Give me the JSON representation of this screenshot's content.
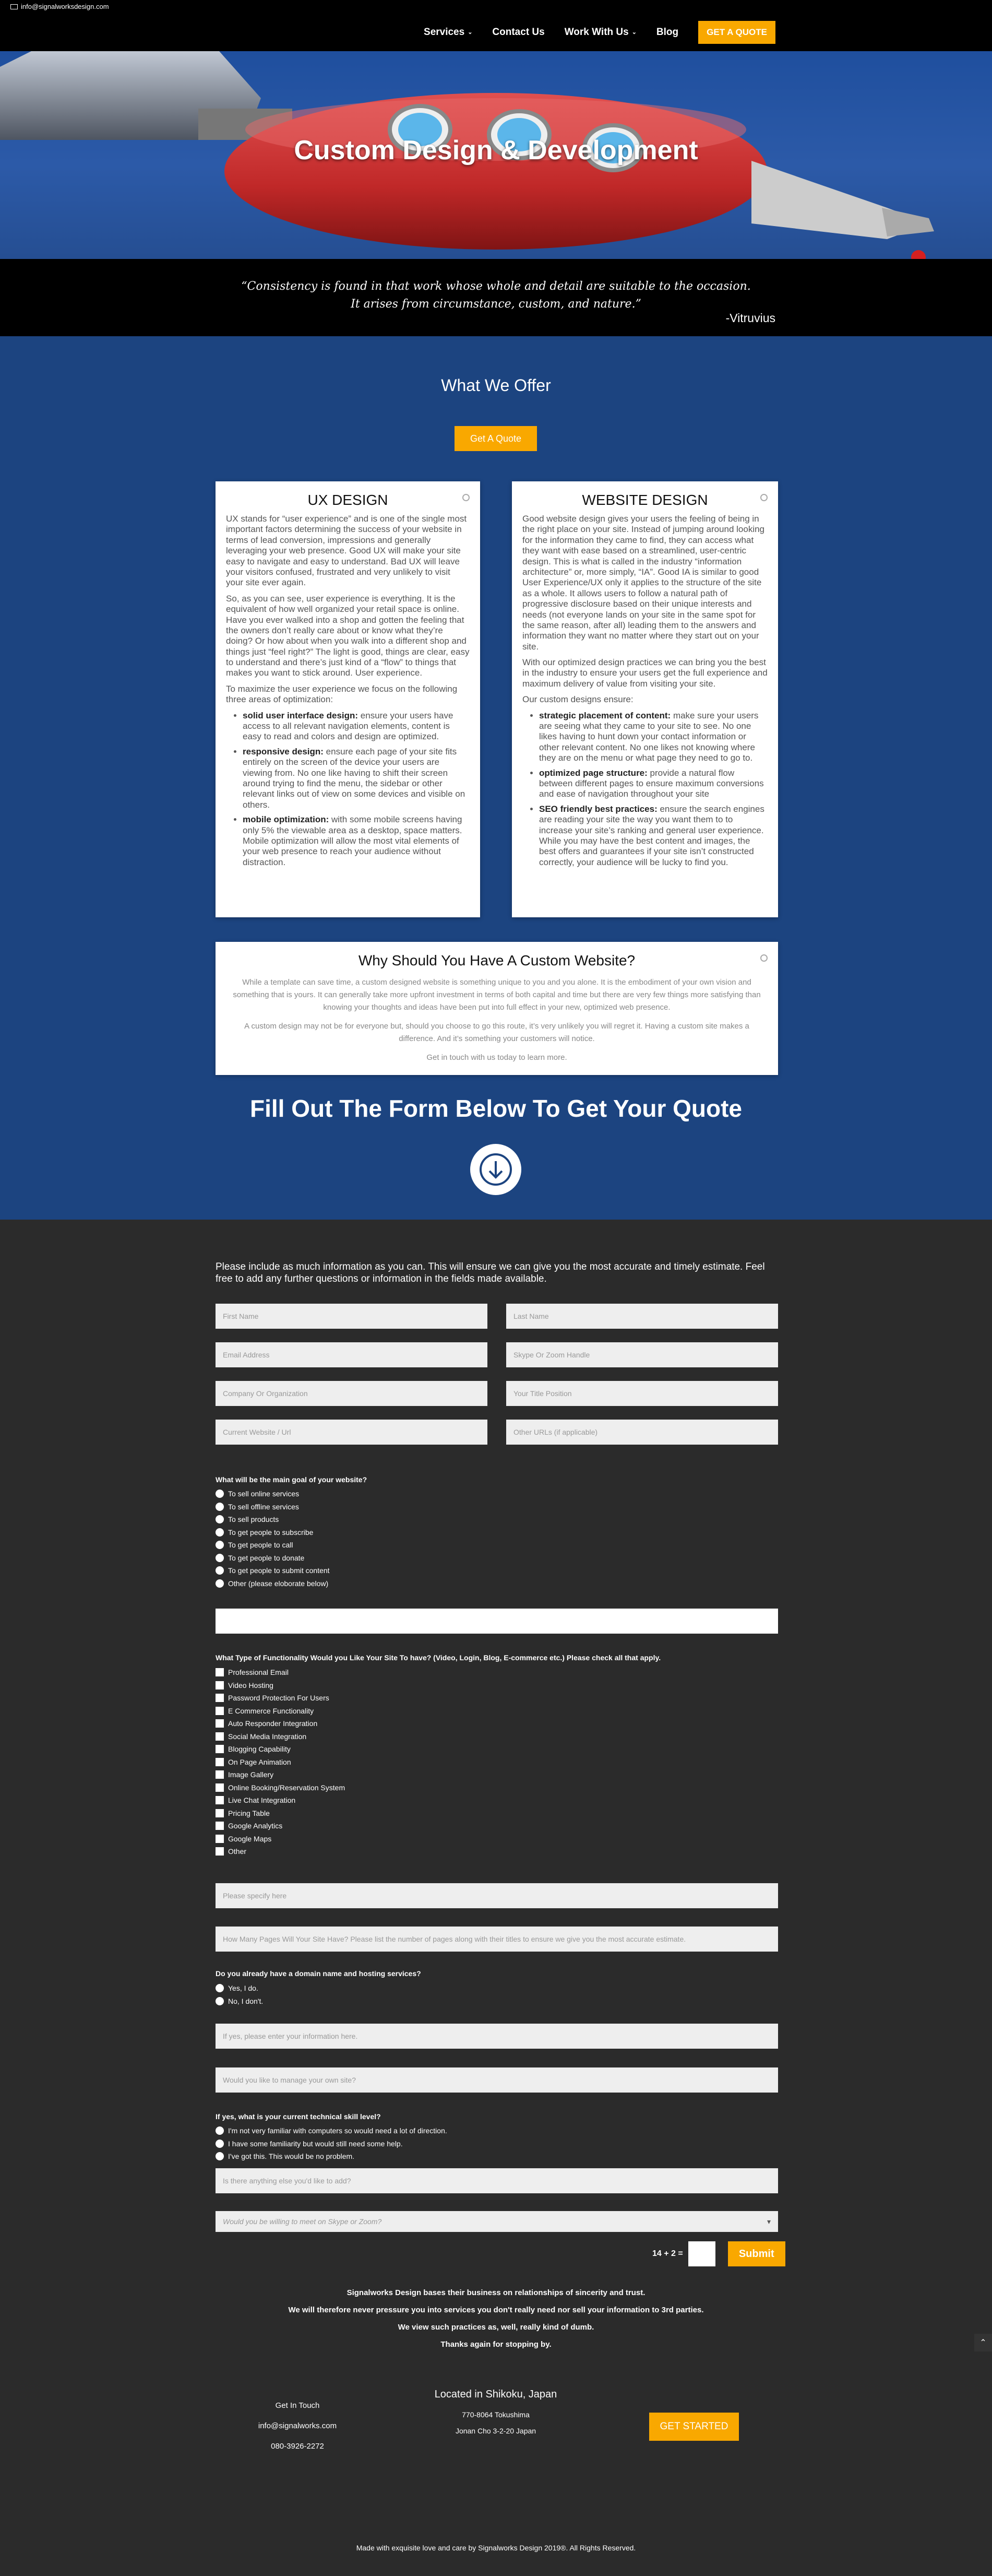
{
  "topbar": {
    "email": "info@signalworksdesign.com"
  },
  "nav": {
    "items": [
      "Services",
      "Contact Us",
      "Work With Us",
      "Blog"
    ],
    "quote_button": "GET A QUOTE"
  },
  "hero": {
    "title": "Custom Design & Development"
  },
  "quote": {
    "line1": "“Consistency is found in that work whose whole and detail are suitable to the occasion.",
    "line2": "It arises from circumstance, custom, and nature.”",
    "author": "-Vitruvius"
  },
  "offer": {
    "title": "What We Offer",
    "button": "Get A Quote",
    "ux": {
      "title": "UX DESIGN",
      "p1": "UX stands for “user experience” and is one of the single most important factors determining the success of your website in terms of lead conversion, impressions and generally leveraging your web presence. Good UX will make your site easy to navigate and easy to understand.  Bad UX will leave your visitors confused, frustrated and very unlikely to visit your site ever again.",
      "p2": "So, as you can see, user experience is everything. It is the equivalent of how well organized your retail space is online. Have you ever walked into a shop and gotten the feeling that the owners don’t really care about or know what they’re doing? Or how about when you walk into a different shop and things just “feel right?” The light is good, things are clear, easy to understand and there’s just kind of a “flow” to things that makes you want to stick around. User experience.",
      "p3": "To maximize the user experience we focus on the following three areas of optimization:",
      "bullets": [
        {
          "b": "solid user interface design:",
          "t": " ensure your users have access to all relevant navigation elements, content is easy to read and colors and design are optimized."
        },
        {
          "b": "responsive design:",
          "t": " ensure each page of your site fits entirely on the screen of the device your users are viewing from. No one like having to shift their screen around trying to find the menu, the sidebar or other relevant links out of view on some devices and visible on others."
        },
        {
          "b": "mobile optimization:",
          "t": " with some mobile screens having only 5% the viewable area as a desktop, space matters. Mobile optimization will allow the most vital elements of your web presence to reach your audience without distraction."
        }
      ]
    },
    "web": {
      "title": "WEBSITE DESIGN",
      "p1": "Good website design gives your users the feeling of being in the right place on your site. Instead of jumping around looking for the information they came to find, they can access what they want with ease based on a streamlined, user-centric design. This is what is called in the industry “information architecture” or, more simply, “IA”.  Good IA is similar to good User Experience/UX only it applies to the structure of the site as a whole. It allows users to follow a natural path of progressive disclosure based on their unique interests and needs (not everyone lands on your site in the same spot for the same reason, after all) leading them to the answers and information they want no matter where they start out on your site.",
      "p2": "With our optimized design practices we can bring you the best in the industry to ensure your users get the full experience and maximum delivery of value from visiting your site.",
      "p3": "Our custom designs ensure:",
      "bullets": [
        {
          "b": "strategic placement of content:",
          "t": " make sure your users are seeing what they came to your site to see. No one likes having to hunt down your contact information or other relevant content. No one likes not knowing where they are on the menu or what page they need to go to."
        },
        {
          "b": "optimized page structure:",
          "t": " provide a natural flow between different pages to ensure maximum conversions and ease of navigation throughout your site"
        },
        {
          "b": "SEO friendly best practices:",
          "t": " ensure the search engines are reading your site the way you want them to to increase your site’s ranking and general user experience. While you may have the best content and images, the best offers and guarantees if your site isn’t constructed correctly, your audience will be lucky to find you."
        }
      ]
    },
    "why": {
      "title": "Why Should You Have A Custom Website?",
      "p1": "While a template can save time, a custom designed website is something unique to you and you alone. It is the embodiment of your own vision and something that is yours. It can generally take more upfront investment in terms of both capital and time but there are very few things more satisfying than knowing your thoughts and ideas have been put into full effect in your new, optimized web presence.",
      "p2": "A custom design may not be for everyone but, should you choose to go this route, it’s very unlikely you will regret it. Having a custom site makes a difference. And it’s something your customers will notice.",
      "p3": "Get in touch with us today to learn more."
    },
    "fill_title": "Fill Out The Form Below To Get Your Quote"
  },
  "form": {
    "intro": "Please include as much information as you can. This will ensure we can give you the most accurate and timely estimate. Feel free to add any further questions or information in the fields made available.",
    "first_name": "First Name",
    "last_name": "Last Name",
    "email": "Email Address",
    "skype": "Skype Or Zoom Handle",
    "company": "Company Or Organization",
    "title_position": "Your Title Position",
    "current_website": "Current Website / Url",
    "other_urls": "Other URLs (if applicable)",
    "goal_label": "What will be the main goal of your website?",
    "goals": [
      "To sell online services",
      "To sell offline services",
      "To sell products",
      "To get people to subscribe",
      "To get people to call",
      "To get people to donate",
      "To get people to submit content",
      "Other (please eloborate below)"
    ],
    "func_label": "What Type of Functionality Would you Like Your Site To have? (Video, Login, Blog, E-commerce etc.) Please check all that apply.",
    "functions": [
      "Professional Email",
      "Video Hosting",
      "Password Protection For Users",
      "E Commerce Functionality",
      "Auto Responder Integration",
      "Social Media Integration",
      "Blogging Capability",
      "On Page Animation",
      "Image Gallery",
      "Online Booking/Reservation System",
      "Live Chat Integration",
      "Pricing Table",
      "Google Analytics",
      "Google Maps",
      "Other"
    ],
    "specify": "Please specify here",
    "pages": "How Many Pages Will Your Site Have? Please list the number of pages along with their titles to ensure we give you the most accurate estimate.",
    "domain_label": "Do you already have a domain name and hosting services?",
    "domain_opts": [
      "Yes, I do.",
      "No, I don't."
    ],
    "domain_info": "If yes, please enter your information here.",
    "manage": "Would you like to manage your own site?",
    "skill_label": "If yes, what is your current technical skill level?",
    "skills": [
      "I'm not very familiar with computers so would need a lot of direction.",
      "I have some familiarity but would still need some help.",
      "I've got this. This would be no problem."
    ],
    "anything_else": "Is there anything else you'd like to add?",
    "meet_select": "Would you be willing to meet on Skype or Zoom?",
    "captcha": "14 + 2 =",
    "submit": "Submit",
    "promise": [
      "Signalworks Design bases their business on relationships of sincerity and trust.",
      "We will therefore never pressure you into services you don't really need nor sell your information to 3rd parties.",
      "We view such practices as, well, really kind of dumb.",
      "Thanks again for stopping by."
    ]
  },
  "footer": {
    "contact_title": "Get In Touch",
    "contact_email": "info@signalworks.com",
    "contact_phone": "080-3926-2272",
    "location_title": "Located in Shikoku, Japan",
    "address1": "770-8064 Tokushima",
    "address2": "Jonan Cho 3-2-20 Japan",
    "button": "GET STARTED",
    "copyright": "Made with exquisite love and care by Signalworks Design 2019®. All Rights Reserved."
  }
}
